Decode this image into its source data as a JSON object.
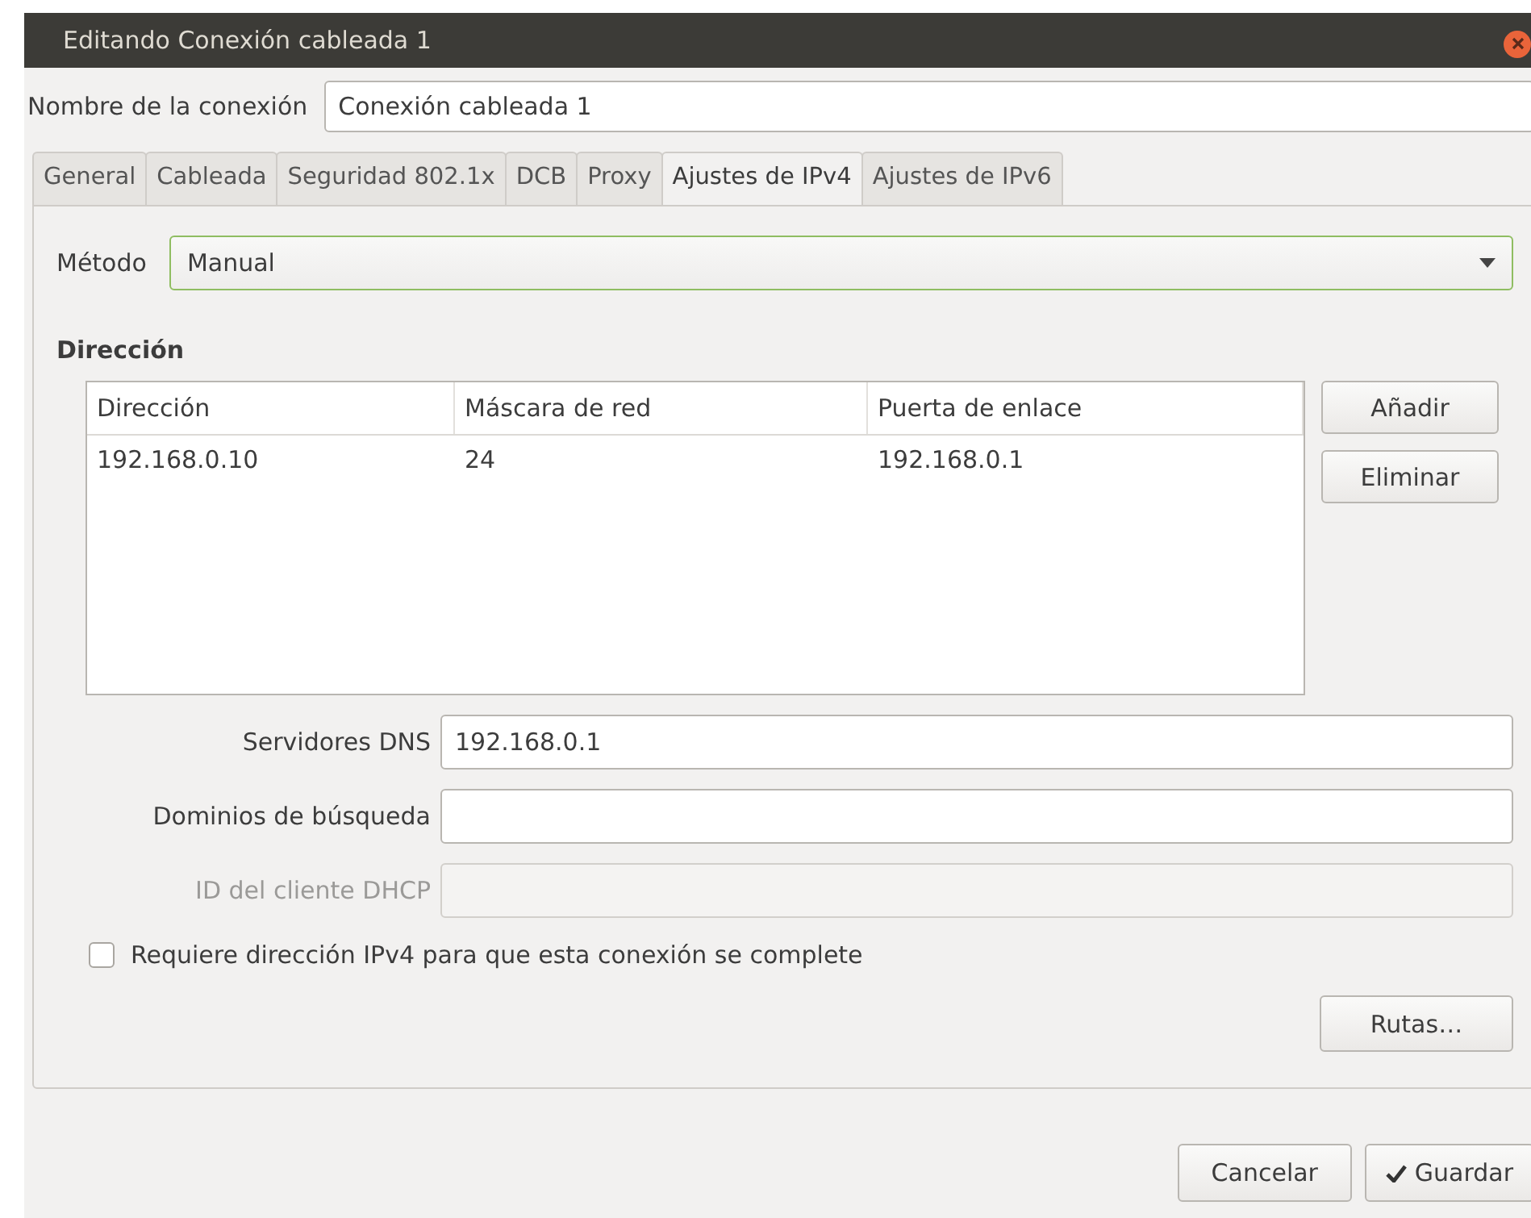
{
  "window": {
    "title": "Editando Conexión cableada 1"
  },
  "connection_name": {
    "label": "Nombre de la conexión",
    "value": "Conexión cableada 1"
  },
  "tabs": [
    {
      "label": "General",
      "selected": false
    },
    {
      "label": "Cableada",
      "selected": false
    },
    {
      "label": "Seguridad 802.1x",
      "selected": false
    },
    {
      "label": "DCB",
      "selected": false
    },
    {
      "label": "Proxy",
      "selected": false
    },
    {
      "label": "Ajustes de IPv4",
      "selected": true
    },
    {
      "label": "Ajustes de IPv6",
      "selected": false
    }
  ],
  "method": {
    "label": "Método",
    "value": "Manual"
  },
  "address_section": {
    "title": "Dirección",
    "table": {
      "columns": [
        "Dirección",
        "Máscara de red",
        "Puerta de enlace"
      ],
      "rows": [
        [
          "192.168.0.10",
          "24",
          "192.168.0.1"
        ]
      ]
    },
    "buttons": [
      "Añadir",
      "Eliminar"
    ]
  },
  "fields": [
    {
      "label": "Servidores DNS",
      "value": "192.168.0.1",
      "disabled": false
    },
    {
      "label": "Dominios de búsqueda",
      "disabled": false
    },
    {
      "label": "ID del cliente DHCP",
      "disabled": true
    }
  ],
  "require_ipv4": {
    "label": "Requiere dirección IPv4 para que esta conexión se complete",
    "checked": false
  },
  "routes_button": "Rutas…",
  "dialog_buttons": [
    {
      "label": "Cancelar",
      "kind": "plain"
    },
    {
      "label": "Guardar",
      "kind": "confirm"
    }
  ]
}
